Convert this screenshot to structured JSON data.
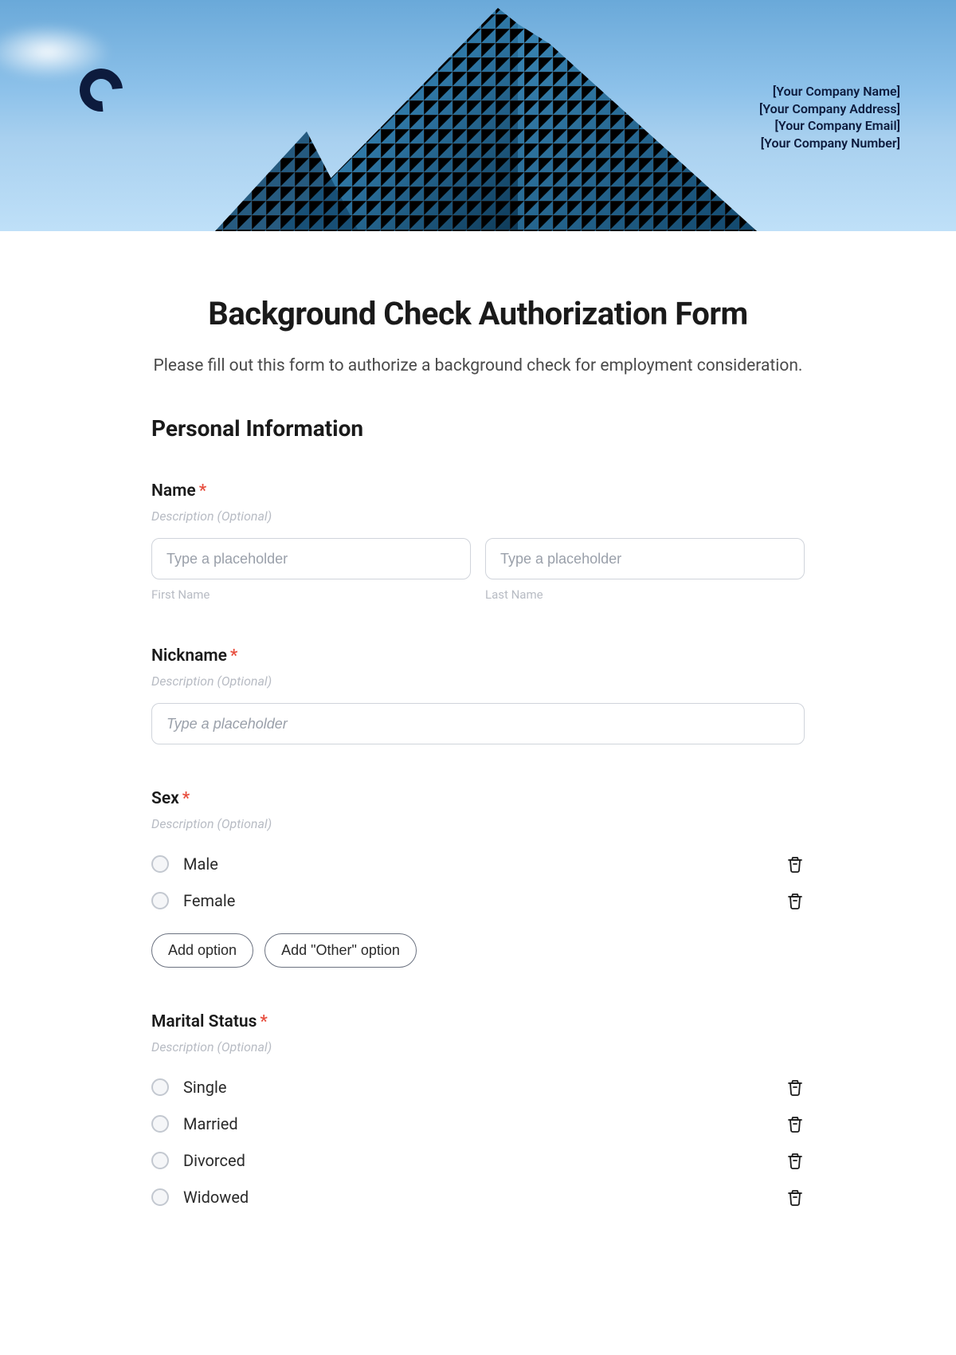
{
  "header": {
    "company_name": "[Your Company Name]",
    "company_address": "[Your Company Address]",
    "company_email": "[Your Company Email]",
    "company_number": "[Your Company Number]"
  },
  "form": {
    "title": "Background Check Authorization Form",
    "subtitle": "Please fill out this form to authorize a background check for employment consideration."
  },
  "section_personal": {
    "heading": "Personal Information"
  },
  "name_field": {
    "label": "Name",
    "required_mark": "*",
    "description": "Description (Optional)",
    "first_placeholder": "Type a placeholder",
    "last_placeholder": "Type a placeholder",
    "first_sublabel": "First Name",
    "last_sublabel": "Last Name"
  },
  "nickname_field": {
    "label": "Nickname",
    "required_mark": "*",
    "description": "Description (Optional)",
    "placeholder": "Type a placeholder"
  },
  "sex_field": {
    "label": "Sex",
    "required_mark": "*",
    "description": "Description (Optional)",
    "options": [
      "Male",
      "Female"
    ],
    "add_option_label": "Add option",
    "add_other_label": "Add \"Other\" option"
  },
  "marital_field": {
    "label": "Marital Status",
    "required_mark": "*",
    "description": "Description (Optional)",
    "options": [
      "Single",
      "Married",
      "Divorced",
      "Widowed"
    ]
  }
}
